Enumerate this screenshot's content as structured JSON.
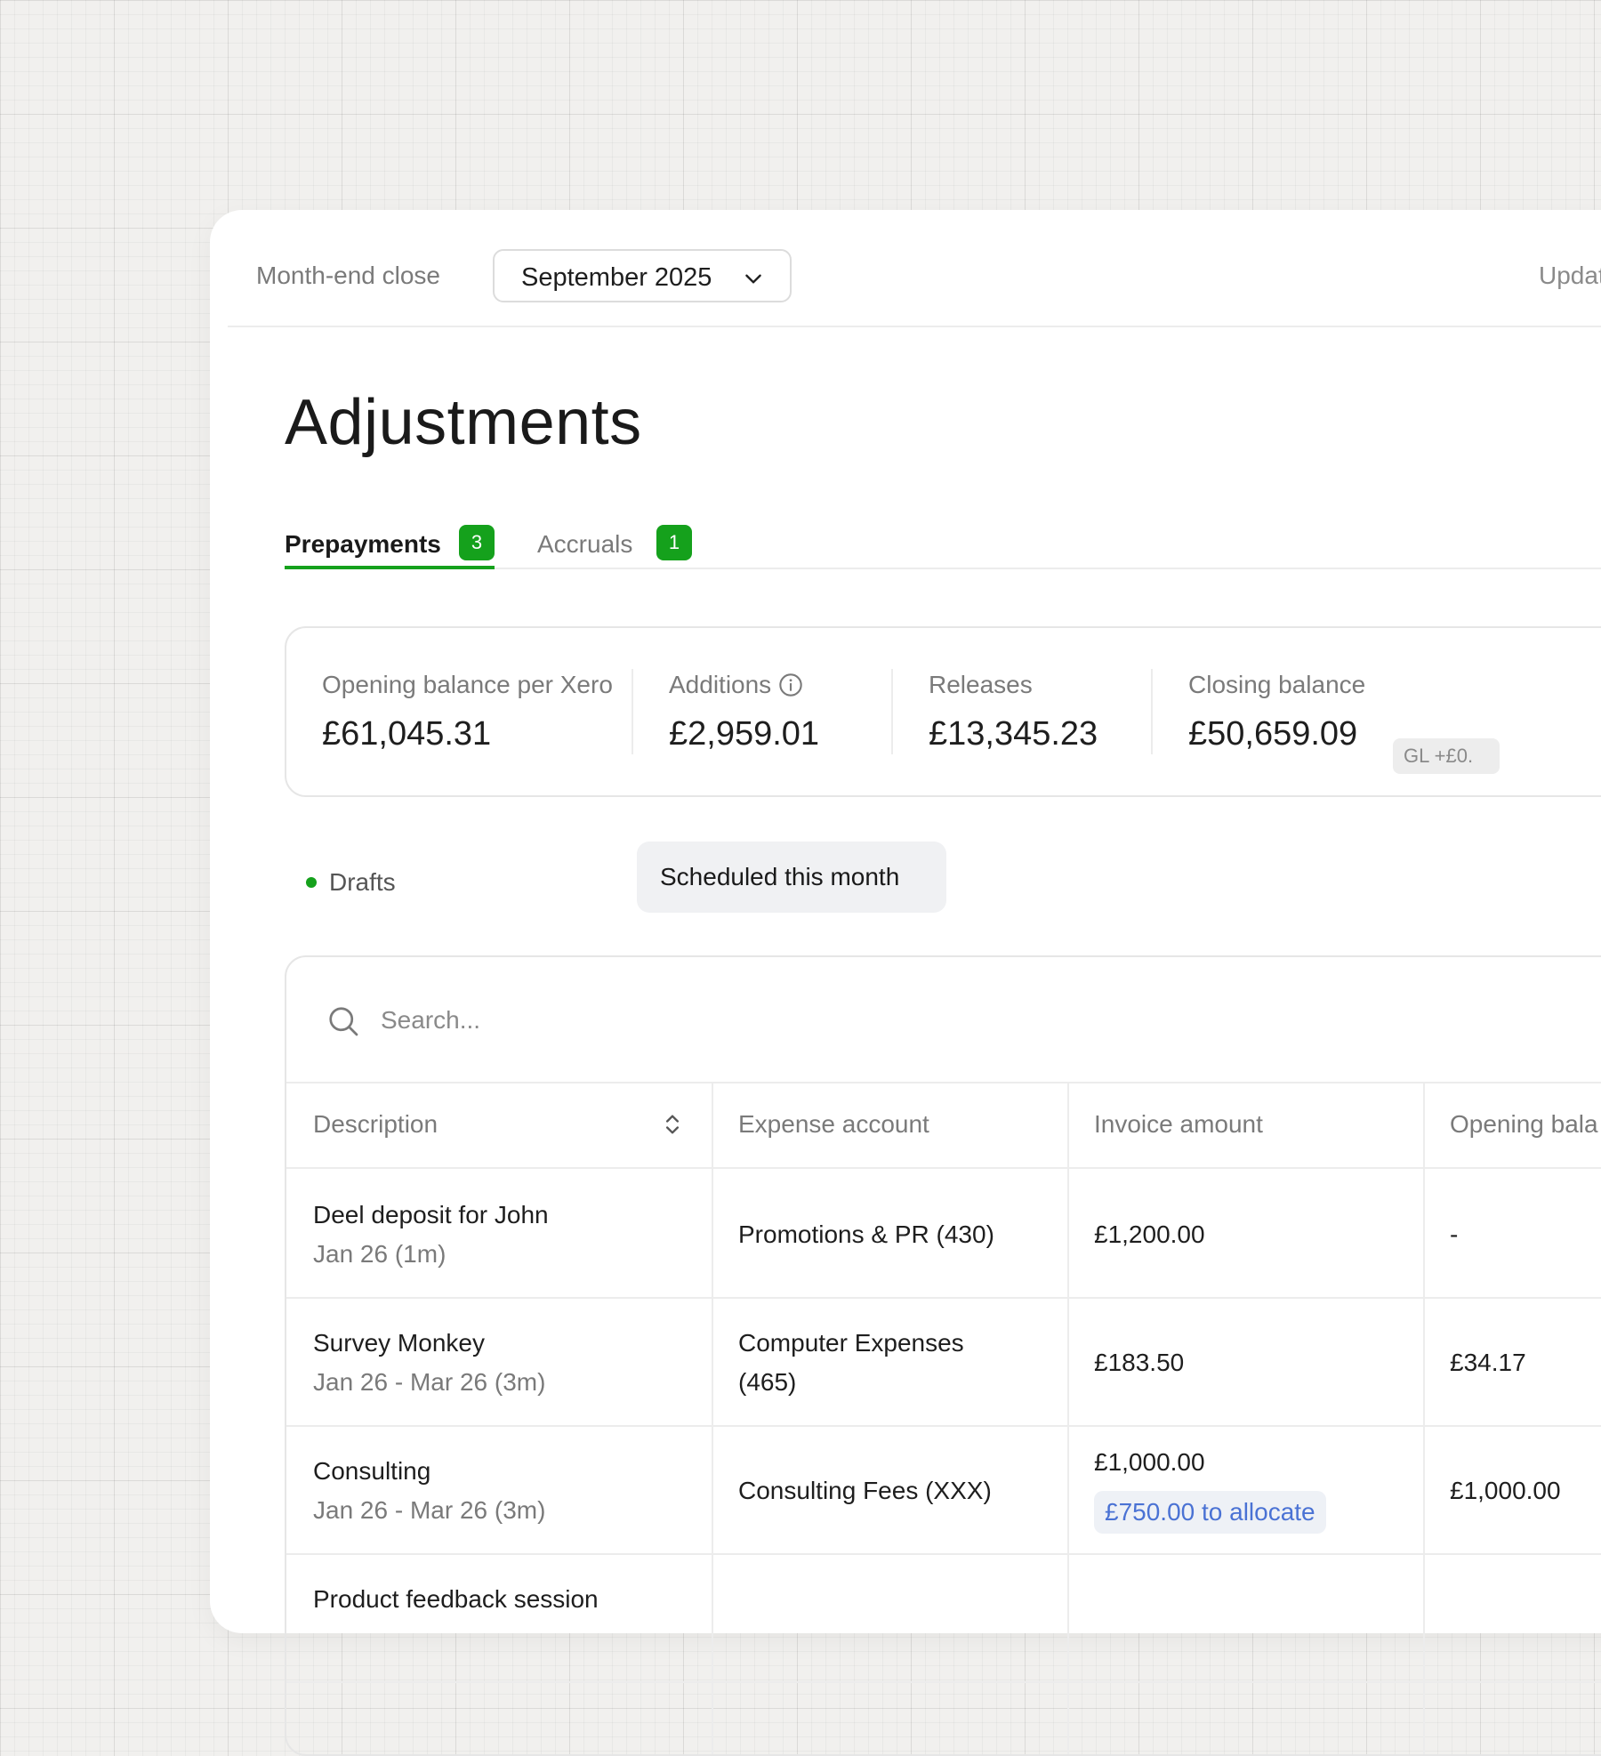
{
  "header": {
    "context_label": "Month-end close",
    "period_select": {
      "value": "September 2025"
    },
    "update_label": "Update"
  },
  "page": {
    "title": "Adjustments"
  },
  "tabs": [
    {
      "label": "Prepayments",
      "count": "3",
      "active": true
    },
    {
      "label": "Accruals",
      "count": "1",
      "active": false
    }
  ],
  "summary": {
    "opening": {
      "label": "Opening balance per Xero",
      "value": "£61,045.31"
    },
    "additions": {
      "label": "Additions",
      "value": "£2,959.01"
    },
    "releases": {
      "label": "Releases",
      "value": "£13,345.23"
    },
    "closing": {
      "label": "Closing balance",
      "value": "£50,659.09",
      "gl_badge": "GL +£0."
    }
  },
  "filters": {
    "drafts": "Drafts",
    "scheduled": "Scheduled this month"
  },
  "search": {
    "placeholder": "Search..."
  },
  "table": {
    "columns": [
      "Description",
      "Expense account",
      "Invoice amount",
      "Opening bala"
    ],
    "rows": [
      {
        "description": "Deel deposit for John",
        "period": "Jan 26 (1m)",
        "account_line1": "Promotions & PR (430)",
        "account_line2": "",
        "invoice": "£1,200.00",
        "allocate": "",
        "opening": "-"
      },
      {
        "description": "Survey Monkey",
        "period": "Jan 26 - Mar 26 (3m)",
        "account_line1": "Computer Expenses",
        "account_line2": "(465)",
        "invoice": "£183.50",
        "allocate": "",
        "opening": "£34.17"
      },
      {
        "description": "Consulting",
        "period": "Jan 26 - Mar 26 (3m)",
        "account_line1": "Consulting Fees (XXX)",
        "account_line2": "",
        "invoice": "£1,000.00",
        "allocate": "£750.00 to allocate",
        "opening": "£1,000.00"
      },
      {
        "description": "Product feedback session",
        "period": "",
        "account_line1": "",
        "account_line2": "",
        "invoice": "",
        "allocate": "",
        "opening": ""
      }
    ]
  },
  "colors": {
    "accent_green": "#15a11c",
    "allocate_blue": "#4a72d4"
  }
}
